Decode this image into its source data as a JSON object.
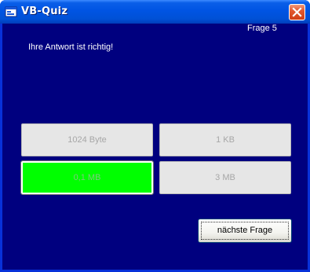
{
  "window": {
    "title": "VB-Quiz",
    "app_icon": "vb-form-icon",
    "close_icon": "close-icon"
  },
  "quiz": {
    "question_counter": "Frage 5",
    "feedback": "Ihre Antwort ist richtig!",
    "answers": [
      {
        "label": "1024 Byte",
        "state": "disabled"
      },
      {
        "label": "1 KB",
        "state": "disabled"
      },
      {
        "label": "0,1 MB",
        "state": "selected-correct"
      },
      {
        "label": "3 MB",
        "state": "disabled"
      }
    ],
    "next_button": "nächste Frage"
  },
  "colors": {
    "client_background": "#00007f",
    "correct_answer": "#00ff00",
    "titlebar": "#0054e3"
  }
}
